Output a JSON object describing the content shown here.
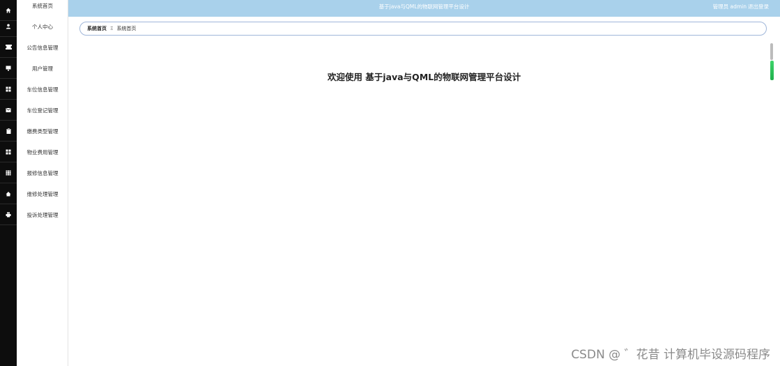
{
  "header": {
    "title": "基于java与QML的物联网管理平台设计",
    "user": "管理员 admin",
    "logout": "退出登录",
    "color": "#a9d1eb"
  },
  "sidebar": {
    "items": [
      {
        "label": "系统首页",
        "icon": "home-icon"
      },
      {
        "label": "个人中心",
        "icon": "user-icon"
      },
      {
        "label": "公告信息管理",
        "icon": "ticket-icon"
      },
      {
        "label": "用户管理",
        "icon": "monitor-icon"
      },
      {
        "label": "车位信息管理",
        "icon": "grid-icon"
      },
      {
        "label": "车位登记管理",
        "icon": "mail-icon"
      },
      {
        "label": "缴费类型管理",
        "icon": "clipboard-icon"
      },
      {
        "label": "物业费用管理",
        "icon": "grid-icon"
      },
      {
        "label": "报修信息管理",
        "icon": "table-icon"
      },
      {
        "label": "维修处理管理",
        "icon": "house-icon"
      },
      {
        "label": "投诉处理管理",
        "icon": "print-icon"
      }
    ]
  },
  "breadcrumb": {
    "home": "系统首页",
    "separator": "Ξ",
    "current": "系统首页"
  },
  "main": {
    "welcome": "欢迎使用 基于java与QML的物联网管理平台设计"
  },
  "watermark": "CSDN @ ゛花昔  计算机毕设源码程序"
}
